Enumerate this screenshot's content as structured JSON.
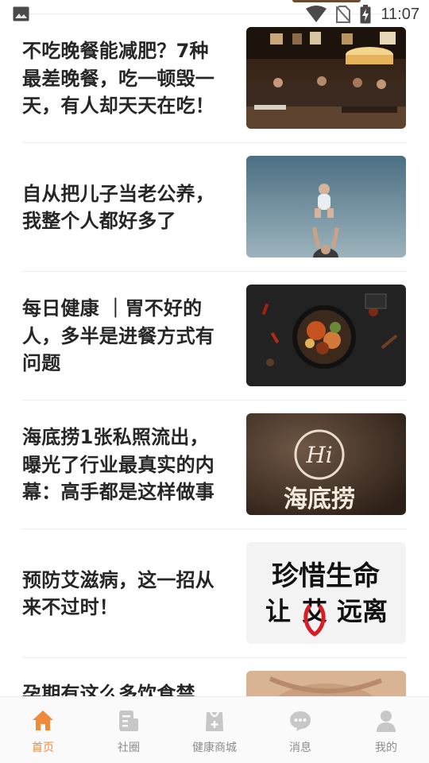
{
  "status_bar": {
    "time": "11:07",
    "icons": [
      "gallery-icon",
      "wifi-icon",
      "no-sim-icon",
      "battery-charging-icon"
    ]
  },
  "feed": {
    "articles": [
      {
        "title": "不吃晚餐能减肥？7种最差晚餐，吃一顿毁一天，有人却天天在吃！",
        "lines": [
          "不吃晚餐能减肥？7种",
          "最差晚餐，吃一顿毁一",
          "天，有人却天天在吃！"
        ],
        "image": "restaurant-photo"
      },
      {
        "title": "自从把儿子当老公养，我整个人都好多了",
        "lines": [
          "自从把儿子当老公养，",
          "我整个人都好多了"
        ],
        "image": "child-thrown-in-air-photo"
      },
      {
        "title": "每日健康 | 胃不好的人，多半是进餐方式有问题",
        "lines": [
          "每日健康 ｜胃不好的",
          "人，多半是进餐方式有",
          "问题"
        ],
        "image": "food-bowl-photo"
      },
      {
        "title": "海底捞1张私照流出，曝光了行业最真实的内幕：高手都是这样做事",
        "lines": [
          "海底捞1张私照流出，",
          "曝光了行业最真实的内",
          "幕：高手都是这样做事"
        ],
        "image": "haidilao-logo-photo",
        "image_text": {
          "hi": "Hi",
          "brand": "海底捞"
        }
      },
      {
        "title": "预防艾滋病，这一招从来不过时！",
        "lines": [
          "预防艾滋病，这一招从",
          "来不过时！"
        ],
        "image": "aids-awareness-poster",
        "image_text": {
          "line1": "珍惜生命",
          "line2a": "让",
          "line2b": "艾",
          "line2c": "远离"
        }
      },
      {
        "title": "孕期有这么多饮食禁",
        "lines": [
          "孕期有这么多饮食禁"
        ],
        "image": "pregnancy-photo"
      }
    ]
  },
  "tabbar": {
    "tabs": [
      {
        "label": "首页",
        "icon": "home-icon",
        "active": true
      },
      {
        "label": "社圈",
        "icon": "community-icon",
        "active": false
      },
      {
        "label": "健康商城",
        "icon": "shop-bag-icon",
        "active": false
      },
      {
        "label": "消息",
        "icon": "message-icon",
        "active": false
      },
      {
        "label": "我的",
        "icon": "profile-icon",
        "active": false
      }
    ]
  },
  "colors": {
    "accent": "#f08a3a",
    "inactive": "#8c8c8c",
    "icon_inactive": "#c7c7c7"
  }
}
